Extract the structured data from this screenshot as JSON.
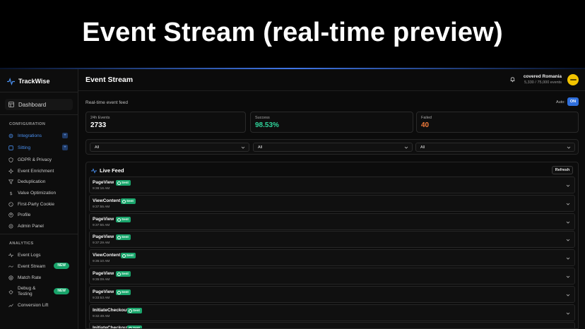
{
  "banner": {
    "title": "Event Stream (real-time preview)"
  },
  "brand": {
    "name": "TrackWise"
  },
  "sidebar": {
    "dashboard": "Dashboard",
    "config_title": "CONFIGURATION",
    "config_items": [
      "Integrations",
      "Sitting",
      "GDPR & Privacy",
      "Event Enrichment",
      "Deduplication",
      "Value Optimization",
      "First-Party Cookie",
      "Profile",
      "Admin Panel"
    ],
    "analytics_title": "ANALYTICS",
    "analytics_items": [
      "Event Logs",
      "Event Stream",
      "Match Rate",
      "Debug & Testing",
      "Conversion Lift"
    ],
    "new_badge": "NEW",
    "plus": "+"
  },
  "header": {
    "title": "Event Stream",
    "account_name": "covered Romania",
    "usage": "5,330 / 75,000 events"
  },
  "feed": {
    "caption": "Real-time event feed",
    "auto_label": "Auto:",
    "auto_state": "ON"
  },
  "stats": [
    {
      "label": "24h Events",
      "value": "2733",
      "color": "#ffffff"
    },
    {
      "label": "Success",
      "value": "98.53%",
      "color": "#2fd39a"
    },
    {
      "label": "Failed",
      "value": "40",
      "color": "#f07a3a"
    }
  ],
  "filters": [
    "All",
    "All",
    "All"
  ],
  "live": {
    "title": "Live Feed",
    "refresh": "Refresh",
    "status_label": "Sent",
    "events": [
      {
        "name": "PageView",
        "time": "9:38:16 AM"
      },
      {
        "name": "ViewContent",
        "time": "9:37:55 AM"
      },
      {
        "name": "PageView",
        "time": "9:37:55 AM"
      },
      {
        "name": "PageView",
        "time": "9:37:29 AM"
      },
      {
        "name": "ViewContent",
        "time": "9:35:10 AM"
      },
      {
        "name": "PageView",
        "time": "9:35:09 AM"
      },
      {
        "name": "PageView",
        "time": "9:33:53 AM"
      },
      {
        "name": "InitiateCheckout",
        "time": "9:32:49 AM"
      },
      {
        "name": "InitiateCheckout",
        "time": ""
      }
    ]
  },
  "colors": {
    "accent": "#2f6fdc",
    "success": "#1aa56c",
    "new_badge": "#18a36a"
  }
}
